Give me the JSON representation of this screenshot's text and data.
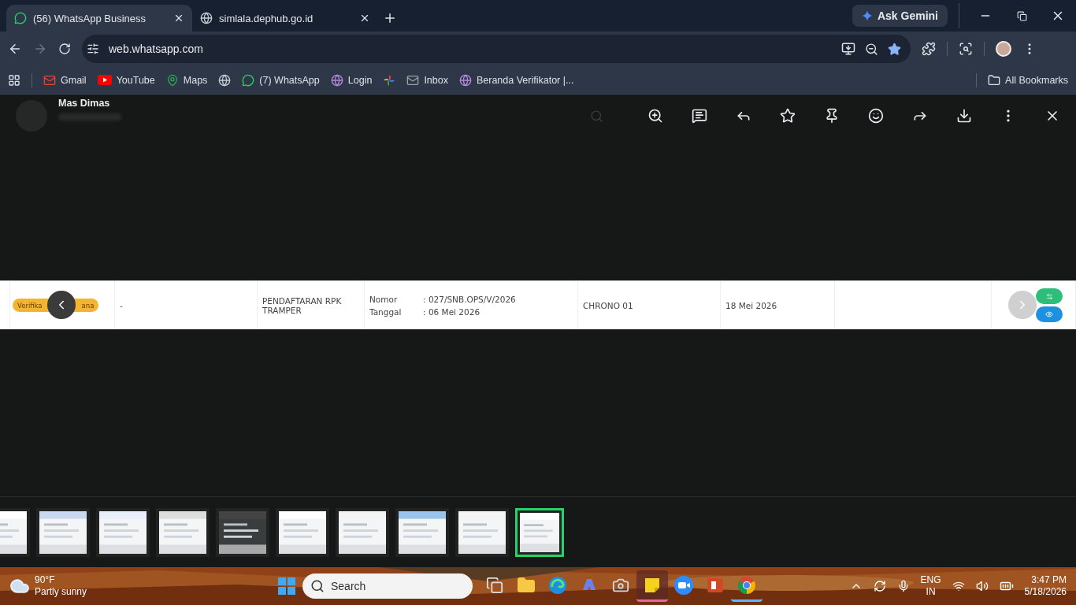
{
  "browser": {
    "tabs": [
      {
        "title": "(56) WhatsApp Business",
        "kind": "whatsapp",
        "selected": true
      },
      {
        "title": "simlala.dephub.go.id",
        "kind": "globe",
        "selected": false
      }
    ],
    "ask_button": "Ask Gemini",
    "url": "web.whatsapp.com",
    "bookmarks": [
      {
        "label": "Gmail",
        "kind": "gmail"
      },
      {
        "label": "YouTube",
        "kind": "youtube"
      },
      {
        "label": "Maps",
        "kind": "maps"
      },
      {
        "kind": "globe"
      },
      {
        "label": "(7) WhatsApp",
        "kind": "whatsapp"
      },
      {
        "label": "Login",
        "kind": "emblem"
      },
      {
        "kind": "pinwheel"
      },
      {
        "label": "Inbox",
        "kind": "mail"
      },
      {
        "label": "Beranda Verifikator |...",
        "kind": "emblem"
      }
    ],
    "all_bookmarks": "All Bookmarks"
  },
  "viewer": {
    "contact": "Mas Dimas",
    "document_row": {
      "status_badge": [
        "Verifika",
        "ana"
      ],
      "column_2": "-",
      "column_3": "PENDAFTARAN RPK TRAMPER",
      "fields": [
        {
          "label": "Nomor",
          "value": ": 027/SNB.OPS/V/2026"
        },
        {
          "label": "Tanggal",
          "value": ": 06 Mei 2026"
        }
      ],
      "column_5": "CHRONO 01",
      "column_6": "18 Mei 2026"
    },
    "thumbnails": [
      {
        "kind": "picture",
        "selected": false
      },
      {
        "kind": "picture",
        "selected": false
      },
      {
        "kind": "picture",
        "selected": false
      },
      {
        "kind": "picture",
        "selected": false
      },
      {
        "kind": "picture",
        "selected": false
      },
      {
        "kind": "picture",
        "selected": false
      },
      {
        "kind": "picture",
        "selected": false
      },
      {
        "kind": "picture",
        "selected": false
      },
      {
        "kind": "picture",
        "selected": false
      },
      {
        "kind": "picture",
        "selected": true
      }
    ]
  },
  "taskbar": {
    "weather": {
      "temperature": "90°F",
      "condition": "Partly sunny"
    },
    "search_placeholder": "Search",
    "apps": [
      {
        "kind": "taskview",
        "running": false
      },
      {
        "kind": "explorer",
        "running": false
      },
      {
        "kind": "edge",
        "running": false
      },
      {
        "kind": "copilot",
        "running": false
      },
      {
        "kind": "camera",
        "running": false
      },
      {
        "kind": "sticky",
        "running": true
      },
      {
        "kind": "zoom",
        "running": false
      },
      {
        "kind": "powerpoint",
        "running": false
      },
      {
        "kind": "chrome",
        "running": true
      }
    ],
    "language": "ENG",
    "region": "IN",
    "time": "3:47 PM",
    "date": "5/18/2026"
  }
}
